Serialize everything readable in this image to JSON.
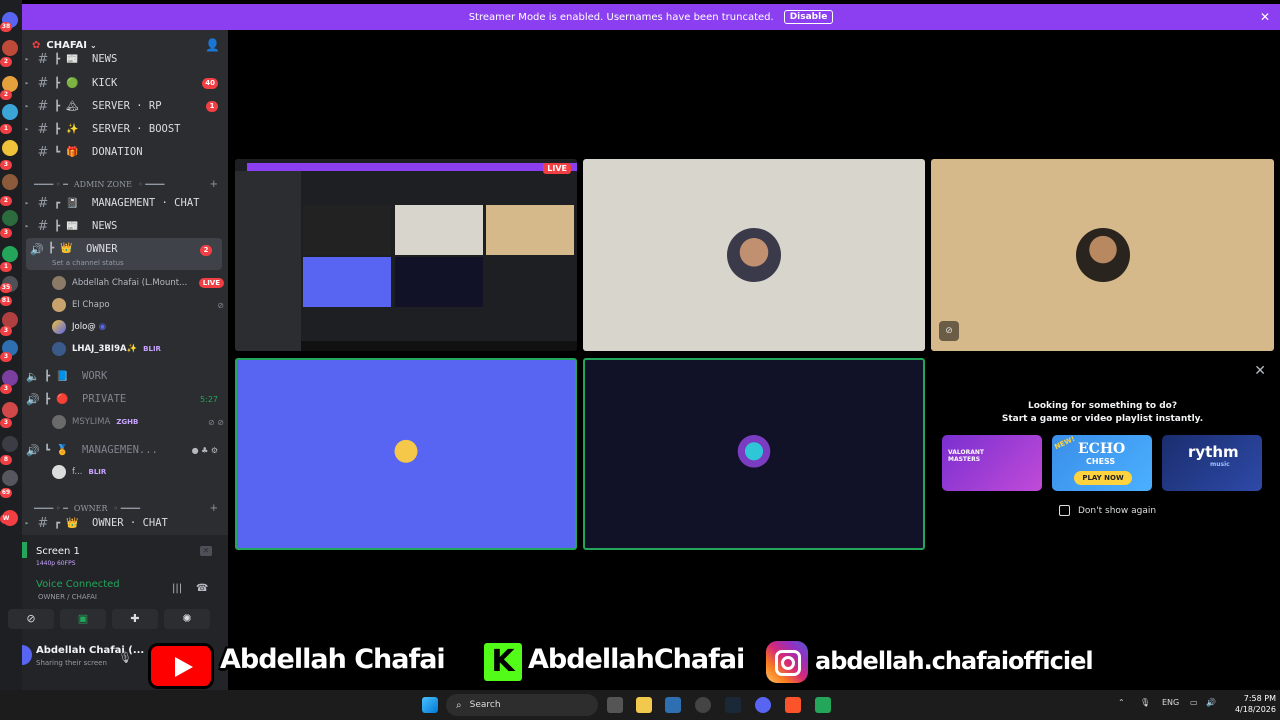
{
  "banner": {
    "text": "Streamer Mode is enabled. Usernames have been truncated.",
    "disable_label": "Disable"
  },
  "guild": {
    "name": "CHAFAI"
  },
  "channels": [
    {
      "name": "NEWS",
      "emoji": "📰",
      "count": ""
    },
    {
      "name": "KICK",
      "emoji": "🟢",
      "count": "40"
    },
    {
      "name": "SERVER · RP",
      "emoji": "🏔",
      "count": "1"
    },
    {
      "name": "SERVER · BOOST",
      "emoji": "✨",
      "count": ""
    },
    {
      "name": "DONATION",
      "emoji": "🎁",
      "count": ""
    }
  ],
  "categories": {
    "admin": "ADMIN ZONE",
    "owner": "OWNER"
  },
  "admin_channels": [
    {
      "name": "MANAGEMENT · CHAT",
      "emoji": "📓"
    },
    {
      "name": "NEWS",
      "emoji": "📰"
    }
  ],
  "owner_voice": {
    "name": "OWNER",
    "emoji": "👑",
    "count": "2",
    "status_hint": "Set a channel status"
  },
  "voice_users": [
    {
      "name": "Abdellah Chafai (L.Mount...",
      "badge": "LIVE"
    },
    {
      "name": "El Chapo",
      "badge": ""
    },
    {
      "name": "Jolo@",
      "badge": ""
    },
    {
      "name": "LHAJ_3BI9A✨",
      "badge": "BLIR"
    }
  ],
  "voice_channels": [
    {
      "name": "WORK",
      "emoji": "📘",
      "timer": ""
    },
    {
      "name": "PRIVATE",
      "emoji": "🔴",
      "timer": "5:27"
    },
    {
      "name": "MANAGEMEN...",
      "emoji": "🏅",
      "timer": ""
    }
  ],
  "private_user": {
    "name": "MSYLIMA",
    "badge": "ZGHB"
  },
  "mgmt_user": {
    "name": "f...",
    "badge": "BLIR"
  },
  "owner_chat": {
    "name": "OWNER · CHAT",
    "emoji": "👑"
  },
  "panel": {
    "screen_title": "Screen 1",
    "screen_quality": "1440p 60FPS",
    "voice_connected": "Voice Connected",
    "voice_channel": "OWNER / CHAFAI",
    "user_name": "Abdellah Chafai (...",
    "user_status": "Sharing their screen"
  },
  "stream": {
    "live_badge": "LIVE"
  },
  "activities": {
    "title": "Looking for something to do?",
    "subtitle": "Start a game or video playlist instantly.",
    "cards": [
      {
        "label": "VALORANT MASTERS",
        "sub": ""
      },
      {
        "label": "ECHO",
        "sub": "CHESS",
        "button": "PLAY NOW",
        "tag": "NEW!"
      },
      {
        "label": "rythm",
        "sub": "music"
      }
    ],
    "dont_show": "Don't show again"
  },
  "socials": {
    "youtube": "Abdellah Chafai",
    "kick": "AbdellahChafai",
    "instagram": "abdellah.chafaiofficiel"
  },
  "taskbar": {
    "search": "Search",
    "lang": "ENG",
    "time": "7:58 PM",
    "date": "4/18/2026"
  },
  "server_badges": [
    "38",
    "2",
    "2",
    "1",
    "3",
    "2",
    "3",
    "1",
    "35",
    "36",
    "81",
    "3",
    "3",
    "3",
    "3",
    "8",
    "60",
    "69",
    "W",
    "1"
  ],
  "colors": {
    "accent": "#5865f2",
    "live": "#f23f43",
    "connected": "#23a55a",
    "banner": "#8b3ff0"
  }
}
